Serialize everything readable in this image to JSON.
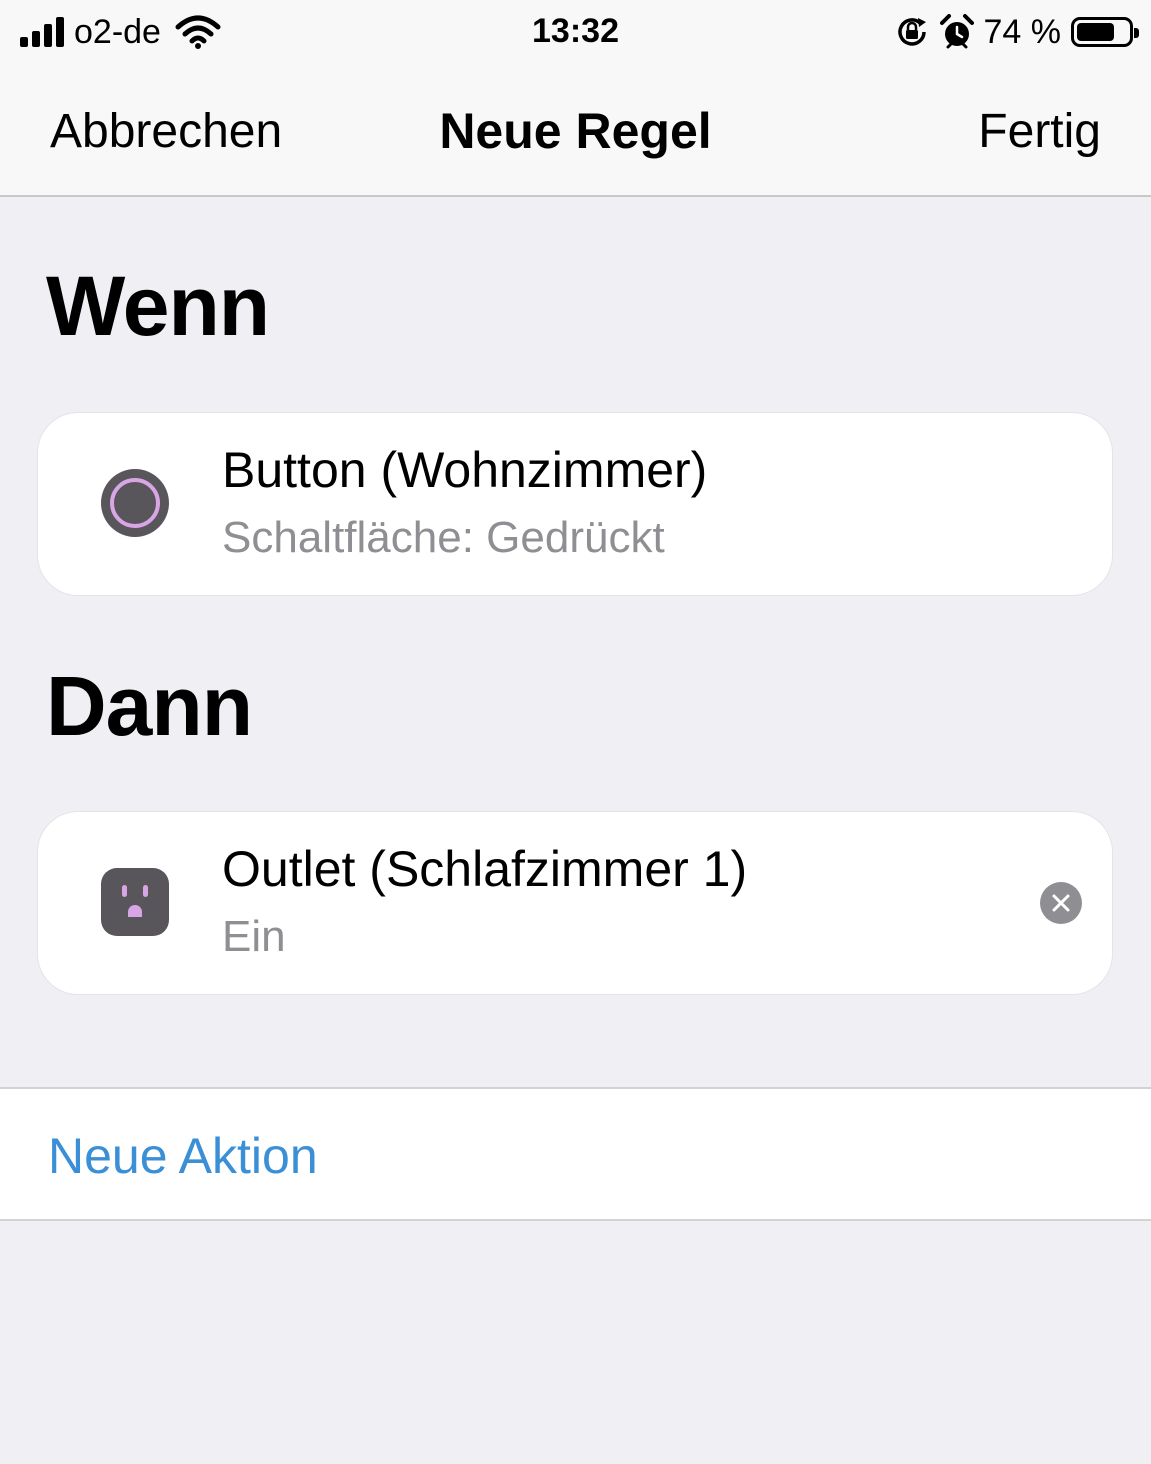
{
  "status_bar": {
    "carrier": "o2-de",
    "time": "13:32",
    "battery_percent": "74 %",
    "battery_level": 0.74,
    "icons": [
      "signal-icon",
      "wifi-icon",
      "orientation-lock-icon",
      "alarm-icon",
      "battery-icon"
    ]
  },
  "nav": {
    "cancel_label": "Abbrechen",
    "title": "Neue Regel",
    "done_label": "Fertig"
  },
  "when": {
    "heading": "Wenn",
    "trigger": {
      "title": "Button (Wohnzimmer)",
      "subtitle": "Schaltfläche: Gedrückt",
      "icon": "button-device-icon"
    }
  },
  "then": {
    "heading": "Dann",
    "action": {
      "title": "Outlet (Schlafzimmer 1)",
      "subtitle": "Ein",
      "icon": "outlet-icon",
      "remove_icon": "remove-icon"
    }
  },
  "new_action": {
    "label": "Neue Aktion"
  },
  "colors": {
    "background": "#efeff4",
    "card": "#ffffff",
    "link_blue": "#3a8fd6",
    "secondary_text": "#8e8e93",
    "icon_gray": "#59565b",
    "icon_accent": "#d8a6e6"
  }
}
